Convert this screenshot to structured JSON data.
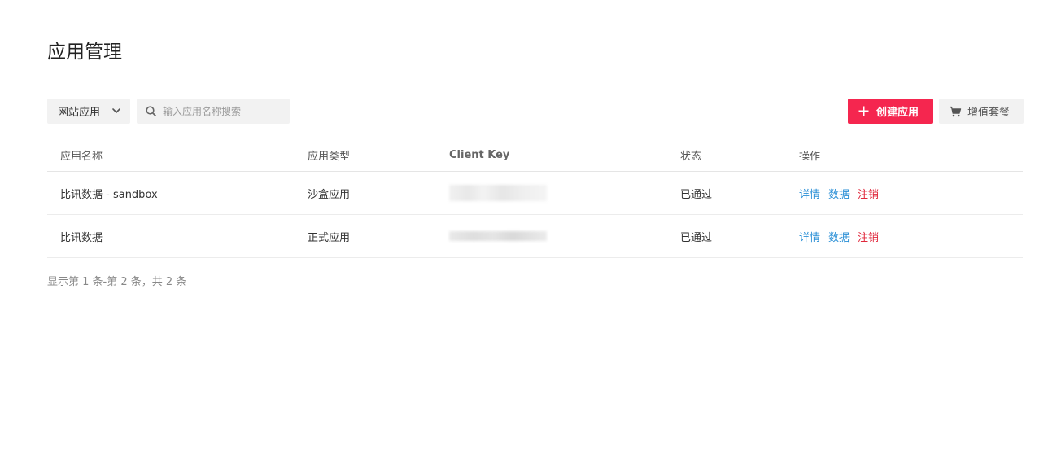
{
  "page": {
    "title": "应用管理"
  },
  "toolbar": {
    "type_select_value": "网站应用",
    "search_placeholder": "输入应用名称搜索",
    "create_label": "创建应用",
    "value_added_label": "增值套餐"
  },
  "table": {
    "headers": {
      "name": "应用名称",
      "type": "应用类型",
      "client_key": "Client Key",
      "status": "状态",
      "ops": "操作"
    },
    "rows": [
      {
        "name": "比讯数据 - sandbox",
        "type": "沙盒应用",
        "status": "已通过",
        "ops": {
          "detail": "详情",
          "data": "数据",
          "cancel": "注销"
        }
      },
      {
        "name": "比讯数据",
        "type": "正式应用",
        "status": "已通过",
        "ops": {
          "detail": "详情",
          "data": "数据",
          "cancel": "注销"
        }
      }
    ]
  },
  "pagination": {
    "summary": "显示第 1 条-第 2 条，共 2 条"
  },
  "colors": {
    "primary_button": "#f5264f",
    "link_blue": "#2a8fd6",
    "link_red": "#e0283c"
  },
  "icons": {
    "select_arrow": "chevron-down-icon",
    "search": "search-icon",
    "create": "plus-icon",
    "value_added": "cart-icon"
  }
}
